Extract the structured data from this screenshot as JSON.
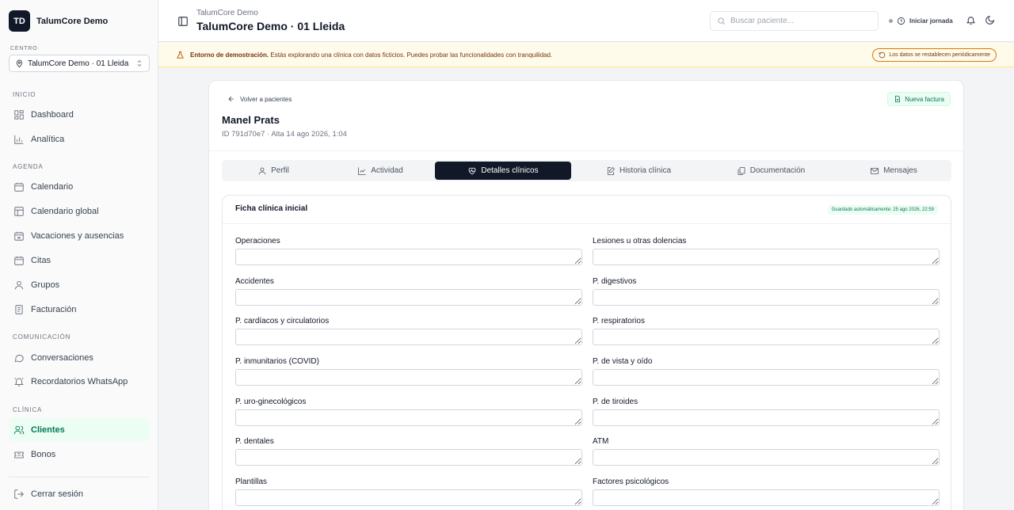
{
  "sidebar": {
    "brand_initials": "TD",
    "brand_name": "TalumCore Demo",
    "centro_label": "CENTRO",
    "centro_value": "TalumCore Demo · 01 Lleida",
    "sections": {
      "inicio": "INICIO",
      "agenda": "AGENDA",
      "comunicacion": "COMUNICACIÓN",
      "clinica": "CLÍNICA"
    },
    "items": {
      "dashboard": "Dashboard",
      "analitica": "Analítica",
      "calendario": "Calendario",
      "calendario_global": "Calendario global",
      "vacaciones": "Vacaciones y ausencias",
      "citas": "Citas",
      "grupos": "Grupos",
      "facturacion": "Facturación",
      "conversaciones": "Conversaciones",
      "recordatorios": "Recordatorios WhatsApp",
      "clientes": "Clientes",
      "bonos": "Bonos"
    },
    "logout": "Cerrar sesión"
  },
  "header": {
    "subtitle": "TalumCore Demo",
    "title": "TalumCore Demo · 01 Lleida",
    "search_placeholder": "Buscar paciente...",
    "jornada_label": "Iniciar jornada"
  },
  "banner": {
    "strong": "Entorno de demostración.",
    "text": "Estás explorando una clínica con datos ficticios. Puedes probar las funcionalidades con tranquilidad.",
    "reset_label": "Los datos se restablecen periódicamente"
  },
  "patient": {
    "back_label": "Volver a pacientes",
    "new_invoice_label": "Nueva factura",
    "name": "Manel Prats",
    "meta": "ID 791d70e7 · Alta 14 ago 2026, 1:04"
  },
  "tabs": {
    "perfil": "Perfil",
    "actividad": "Actividad",
    "detalles": "Detalles clínicos",
    "historia": "Historia clínica",
    "documentacion": "Documentación",
    "mensajes": "Mensajes"
  },
  "form": {
    "title": "Ficha clínica inicial",
    "autosave": "Guardado automáticamente: 25 ago 2026, 22:59",
    "fields": {
      "operaciones": "Operaciones",
      "lesiones": "Lesiones u otras dolencias",
      "accidentes": "Accidentes",
      "digestivos": "P. digestivos",
      "cardiacos": "P. cardíacos y circulatorios",
      "respiratorios": "P. respiratorios",
      "inmunitarios": "P. inmunitarios (COVID)",
      "vista": "P. de vista y oído",
      "uro": "P. uro-ginecológicos",
      "tiroides": "P. de tiroides",
      "dentales": "P. dentales",
      "atm": "ATM",
      "plantillas": "Plantillas",
      "psicologicos": "Factores psicológicos"
    }
  },
  "colors": {
    "accent": "#047857",
    "accent_bg": "#ecfdf3",
    "banner_bg": "#fffbeb",
    "active_tab": "#111827"
  }
}
